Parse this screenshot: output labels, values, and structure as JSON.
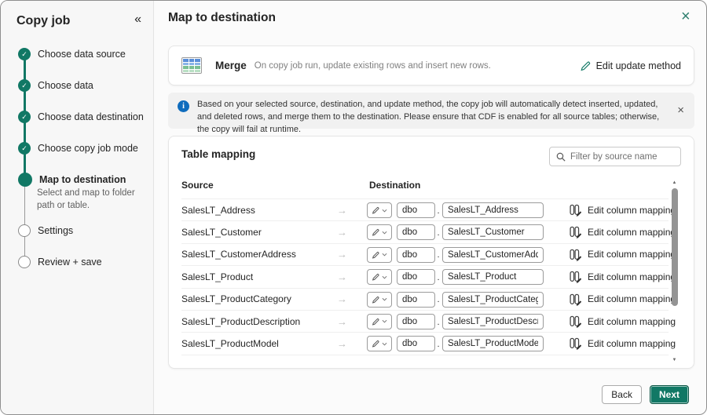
{
  "colors": {
    "accent": "#117865",
    "info_blue": "#0f6cbd"
  },
  "icons": {
    "collapse": "«",
    "close": "×",
    "banner_close": "×",
    "check": "✓",
    "row_arrow": "→",
    "scroll_up": "▲",
    "scroll_down": "▼",
    "info": "i"
  },
  "sidebar": {
    "title": "Copy job",
    "steps": [
      {
        "label": "Choose data source",
        "state": "completed"
      },
      {
        "label": "Choose data",
        "state": "completed"
      },
      {
        "label": "Choose data destination",
        "state": "completed"
      },
      {
        "label": "Choose copy job mode",
        "state": "completed"
      },
      {
        "label": "Map to destination",
        "state": "current",
        "description": "Select and map to folder path or table."
      },
      {
        "label": "Settings",
        "state": "pending"
      },
      {
        "label": "Review + save",
        "state": "pending"
      }
    ]
  },
  "header": {
    "title": "Map to destination"
  },
  "update_method": {
    "name": "Merge",
    "description": "On copy job run, update existing rows and insert new rows.",
    "edit_label": "Edit update method"
  },
  "banner": {
    "text": "Based on your selected source, destination, and update method, the copy job will automatically detect inserted, updated, and deleted rows, and merge them to the destination. Please ensure that CDF is enabled for all source tables; otherwise, the copy will fail at runtime."
  },
  "table_mapping": {
    "title": "Table mapping",
    "filter_placeholder": "Filter by source name",
    "columns": {
      "source": "Source",
      "destination": "Destination"
    },
    "schema_separator": ".",
    "edit_column_label": "Edit column mapping",
    "rows": [
      {
        "source": "SalesLT_Address",
        "schema": "dbo",
        "destination": "SalesLT_Address"
      },
      {
        "source": "SalesLT_Customer",
        "schema": "dbo",
        "destination": "SalesLT_Customer"
      },
      {
        "source": "SalesLT_CustomerAddress",
        "schema": "dbo",
        "destination": "SalesLT_CustomerAddress"
      },
      {
        "source": "SalesLT_Product",
        "schema": "dbo",
        "destination": "SalesLT_Product"
      },
      {
        "source": "SalesLT_ProductCategory",
        "schema": "dbo",
        "destination": "SalesLT_ProductCategory"
      },
      {
        "source": "SalesLT_ProductDescription",
        "schema": "dbo",
        "destination": "SalesLT_ProductDescription"
      },
      {
        "source": "SalesLT_ProductModel",
        "schema": "dbo",
        "destination": "SalesLT_ProductModel"
      }
    ]
  },
  "footer": {
    "back_label": "Back",
    "next_label": "Next"
  }
}
